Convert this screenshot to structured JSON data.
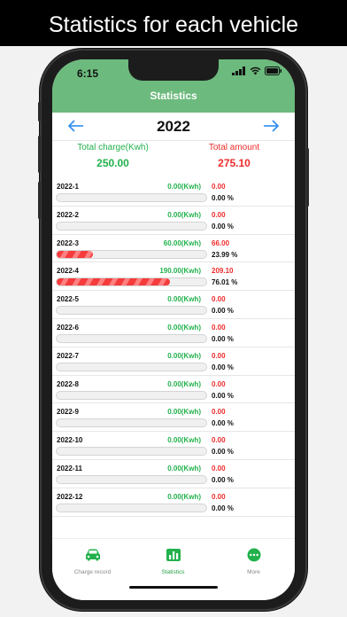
{
  "promo": {
    "caption": "Statistics for each vehicle"
  },
  "status_bar": {
    "time": "6:15"
  },
  "header": {
    "title": "Statistics"
  },
  "year_nav": {
    "year": "2022",
    "prev_icon": "arrow-left-icon",
    "next_icon": "arrow-right-icon"
  },
  "totals": {
    "charge_label": "Total charge(Kwh)",
    "charge_value": "250.00",
    "amount_label": "Total amount",
    "amount_value": "275.10"
  },
  "months": [
    {
      "month": "2022-1",
      "kwh": "0.00(Kwh)",
      "amount": "0.00",
      "percent": "0.00 %",
      "share": 0
    },
    {
      "month": "2022-2",
      "kwh": "0.00(Kwh)",
      "amount": "0.00",
      "percent": "0.00 %",
      "share": 0
    },
    {
      "month": "2022-3",
      "kwh": "60.00(Kwh)",
      "amount": "66.00",
      "percent": "23.99 %",
      "share": 0.2399
    },
    {
      "month": "2022-4",
      "kwh": "190.00(Kwh)",
      "amount": "209.10",
      "percent": "76.01 %",
      "share": 0.7601
    },
    {
      "month": "2022-5",
      "kwh": "0.00(Kwh)",
      "amount": "0.00",
      "percent": "0.00 %",
      "share": 0
    },
    {
      "month": "2022-6",
      "kwh": "0.00(Kwh)",
      "amount": "0.00",
      "percent": "0.00 %",
      "share": 0
    },
    {
      "month": "2022-7",
      "kwh": "0.00(Kwh)",
      "amount": "0.00",
      "percent": "0.00 %",
      "share": 0
    },
    {
      "month": "2022-8",
      "kwh": "0.00(Kwh)",
      "amount": "0.00",
      "percent": "0.00 %",
      "share": 0
    },
    {
      "month": "2022-9",
      "kwh": "0.00(Kwh)",
      "amount": "0.00",
      "percent": "0.00 %",
      "share": 0
    },
    {
      "month": "2022-10",
      "kwh": "0.00(Kwh)",
      "amount": "0.00",
      "percent": "0.00 %",
      "share": 0
    },
    {
      "month": "2022-11",
      "kwh": "0.00(Kwh)",
      "amount": "0.00",
      "percent": "0.00 %",
      "share": 0
    },
    {
      "month": "2022-12",
      "kwh": "0.00(Kwh)",
      "amount": "0.00",
      "percent": "0.00 %",
      "share": 0
    }
  ],
  "tabs": [
    {
      "label": "Charge record",
      "icon": "car-icon",
      "active": false
    },
    {
      "label": "Statistics",
      "icon": "bar-chart-icon",
      "active": true
    },
    {
      "label": "More",
      "icon": "more-dots-icon",
      "active": false
    }
  ],
  "colors": {
    "header_green": "#6cba7d",
    "accent_green": "#22b14c",
    "accent_red": "#ee2b2b",
    "arrow_blue": "#2a8cf0"
  }
}
